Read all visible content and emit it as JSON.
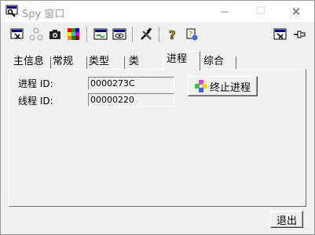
{
  "window": {
    "title": "Spy 窗口"
  },
  "titlebar": {
    "minimize": "—",
    "maximize": "☐",
    "close": "✕"
  },
  "tabs": [
    {
      "label": "主信息"
    },
    {
      "label": "常规"
    },
    {
      "label": "类型"
    },
    {
      "label": "类"
    },
    {
      "label": "进程"
    },
    {
      "label": "综合"
    }
  ],
  "process": {
    "process_id_label": "进程 ID:",
    "process_id_value": "0000273C",
    "thread_id_label": "线程 ID:",
    "thread_id_value": "00000220",
    "terminate_button": "终止进程"
  },
  "footer": {
    "exit_button": "退出"
  }
}
